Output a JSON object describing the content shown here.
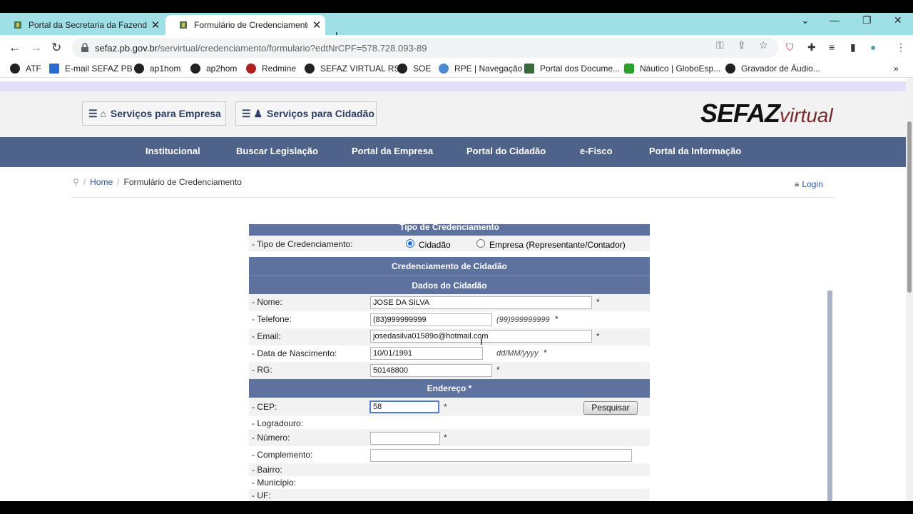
{
  "browser": {
    "tabs": [
      {
        "title": "Portal da Secretaria da Fazenda -",
        "close": "✕"
      },
      {
        "title": "Formulário de Credenciamento -",
        "close": "✕"
      }
    ],
    "new_tab": "+",
    "url_host": "sefaz.pb.gov.br",
    "url_path": "/servirtual/credenciamento/formulario?edtNrCPF=578.728.093-89",
    "bookmarks": [
      "ATF",
      "E-mail SEFAZ PB",
      "ap1hom",
      "ap2hom",
      "Redmine",
      "SEFAZ VIRTUAL RS",
      "SOE",
      "RPE | Navegação",
      "Portal dos Docume...",
      "Náutico | GloboEsp...",
      "Gravador de Áudio..."
    ],
    "bookmarks_more": "»"
  },
  "header": {
    "btn_empresa": "Serviços para Empresa",
    "btn_cidadao": "Serviços para Cidadão",
    "logo_sefaz": "SEFAZ",
    "logo_virtual": "virtual"
  },
  "nav": [
    "Institucional",
    "Buscar Legislação",
    "Portal da Empresa",
    "Portal do Cidadão",
    "e-Fisco",
    "Portal da Informação"
  ],
  "breadcrumb": {
    "home": "Home",
    "current": "Formulário de Credenciamento",
    "sep": "/"
  },
  "login": "Login",
  "form": {
    "tipo_header": "Tipo de Credenciamento",
    "tipo_label": "- Tipo de Credenciamento:",
    "opt_cidadao": "Cidadão",
    "opt_empresa": "Empresa (Representante/Contador)",
    "cred_header": "Credenciamento de Cidadão",
    "dados_header": "Dados do Cidadão",
    "nome_label": "- Nome:",
    "nome_value": "JOSE DA SILVA",
    "tel_label": "- Telefone:",
    "tel_value": "(83)999999999",
    "tel_hint": "(99)999999999",
    "email_label": "- Email:",
    "email_value": "josedasilva01589o@hotmail.com",
    "nasc_label": "- Data de Nascimento:",
    "nasc_value": "10/01/1991",
    "nasc_hint": "dd/MM/yyyy",
    "rg_label": "- RG:",
    "rg_value": "50148800",
    "end_header": "Endereço *",
    "cep_label": "- CEP:",
    "cep_value": "58",
    "pesquisar": "Pesquisar",
    "logradouro_label": "- Logradouro:",
    "numero_label": "- Número:",
    "complemento_label": "- Complemento:",
    "bairro_label": "- Bairro:",
    "municipio_label": "- Município:",
    "uf_label": "- UF:",
    "req": "*"
  },
  "colors": {
    "nav_bg": "#4f6287",
    "section_bg": "#5e72a0",
    "tabstrip": "#9fe0e6"
  }
}
